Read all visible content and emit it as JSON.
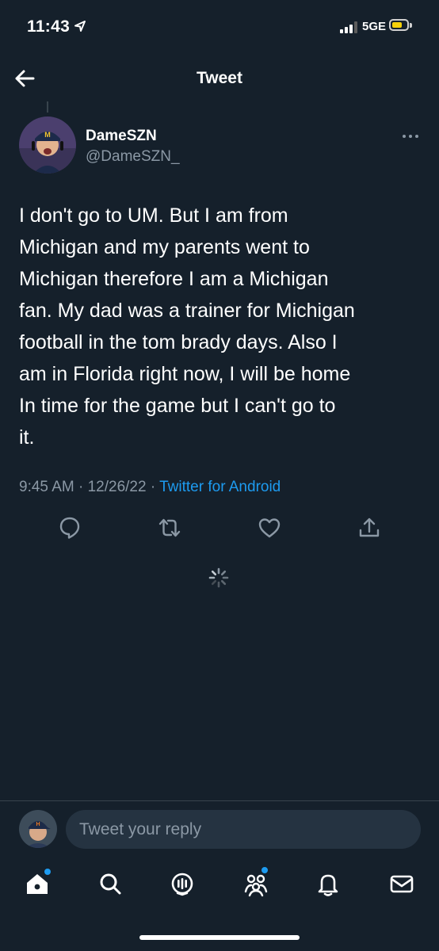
{
  "status_bar": {
    "time": "11:43",
    "network": "5GE",
    "battery_level": 0.55
  },
  "header": {
    "title": "Tweet"
  },
  "tweet": {
    "author_name": "DameSZN",
    "author_handle": "@DameSZN_",
    "text": "I don't go to UM. But I am from\nMichigan and my parents went to\nMichigan therefore I am a Michigan\nfan. My dad was a trainer for Michigan\nfootball in the tom brady days. Also I\nam in Florida right now,  I will be home\nIn time for the game but I can't go to\nit.",
    "time": "9:45 AM",
    "separator": "·",
    "date": "12/26/22",
    "source": "Twitter for Android"
  },
  "actions": [
    "reply-icon",
    "retweet-icon",
    "like-icon",
    "share-icon"
  ],
  "reply": {
    "placeholder": "Tweet your reply"
  },
  "tabs": [
    "home-icon",
    "search-icon",
    "spaces-icon",
    "communities-icon",
    "notifications-icon",
    "messages-icon"
  ],
  "colors": {
    "background": "#15202b",
    "accent": "#1d9bf0",
    "secondary_text": "#8b98a5",
    "icon": "#8b98a5",
    "battery": "#f6d10a"
  }
}
